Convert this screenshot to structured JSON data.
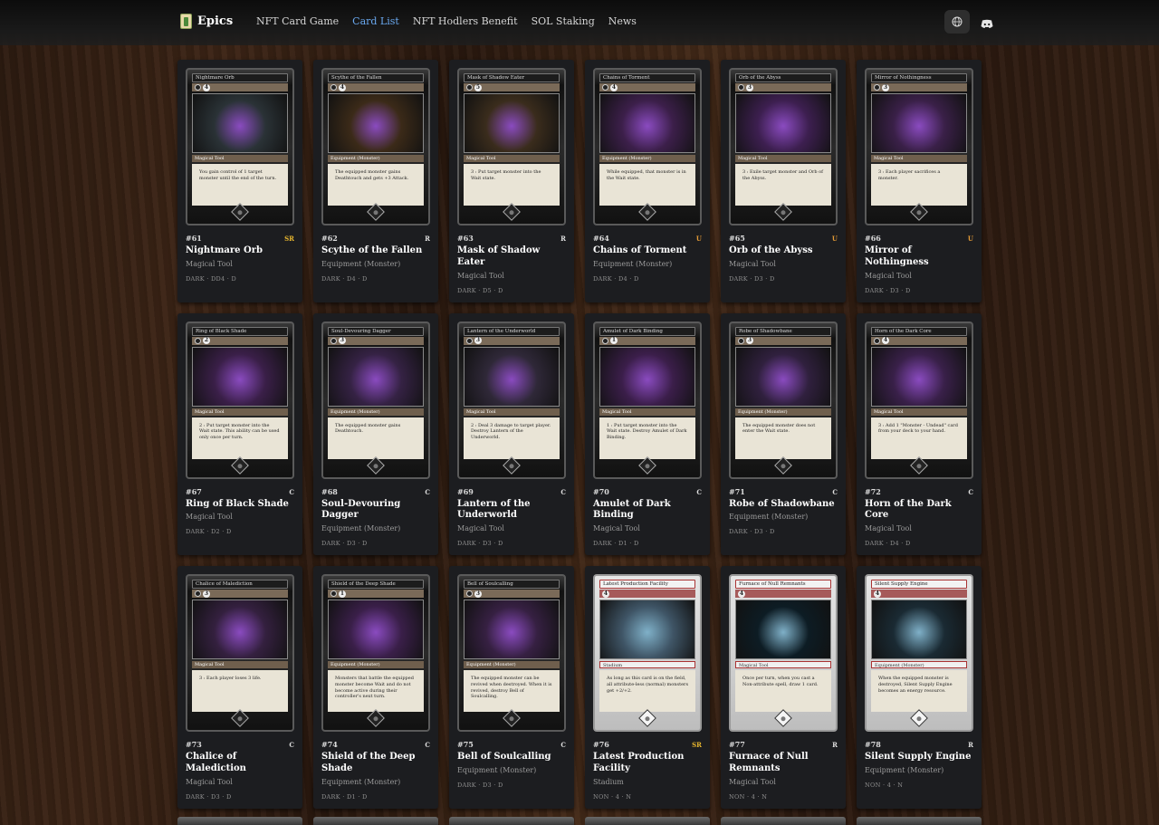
{
  "brand": {
    "name": "Epics"
  },
  "nav": [
    {
      "label": "NFT Card Game",
      "active": false
    },
    {
      "label": "Card List",
      "active": true
    },
    {
      "label": "NFT Hodlers Benefit",
      "active": false
    },
    {
      "label": "SOL Staking",
      "active": false
    },
    {
      "label": "News",
      "active": false
    }
  ],
  "header_icons": [
    "globe-icon",
    "discord-icon"
  ],
  "cards": [
    {
      "number": "#61",
      "name": "Nightmare Orb",
      "type": "Magical Tool",
      "rarity": "SR",
      "stats": "DARK · DD4 · D",
      "cost": "4",
      "art_type": "Magical Tool",
      "text": "You gain control of 1 target monster until the end of the turn.",
      "frame": "dark",
      "art": "#2a3236"
    },
    {
      "number": "#62",
      "name": "Scythe of the Fallen",
      "type": "Equipment (Monster)",
      "rarity": "R",
      "stats": "DARK · D4 · D",
      "cost": "4",
      "art_type": "Equipment (Monster)",
      "text": "The equipped monster gains Deathtouch and gets +3 Attack.",
      "frame": "dark",
      "art": "#3b2a18"
    },
    {
      "number": "#63",
      "name": "Mask of Shadow Eater",
      "type": "Magical Tool",
      "rarity": "R",
      "stats": "DARK · D5 · D",
      "cost": "5",
      "art_type": "Magical Tool",
      "text": "3 : Put target monster into the Wait state.",
      "frame": "dark",
      "art": "#3a2c1c"
    },
    {
      "number": "#64",
      "name": "Chains of Torment",
      "type": "Equipment (Monster)",
      "rarity": "U",
      "stats": "DARK · D4 · D",
      "cost": "4",
      "art_type": "Equipment (Monster)",
      "text": "While equipped, that monster is in the Wait state.",
      "frame": "dark",
      "art": "#3c1f4a"
    },
    {
      "number": "#65",
      "name": "Orb of the Abyss",
      "type": "Magical Tool",
      "rarity": "U",
      "stats": "DARK · D3 · D",
      "cost": "3",
      "art_type": "Magical Tool",
      "text": "3 : Exile target monster and Orb of the Abyss.",
      "frame": "dark",
      "art": "#3d1f50"
    },
    {
      "number": "#66",
      "name": "Mirror of Nothingness",
      "type": "Magical Tool",
      "rarity": "U",
      "stats": "DARK · D3 · D",
      "cost": "3",
      "art_type": "Magical Tool",
      "text": "3 : Each player sacrifices a monster.",
      "frame": "dark",
      "art": "#3a2048"
    },
    {
      "number": "#67",
      "name": "Ring of Black Shade",
      "type": "Magical Tool",
      "rarity": "C",
      "stats": "DARK · D2 · D",
      "cost": "2",
      "art_type": "Magical Tool",
      "text": "2 : Put target monster into the Wait state. This ability can be used only once per turn.",
      "frame": "dark",
      "art": "#3a1f48"
    },
    {
      "number": "#68",
      "name": "Soul-Devouring Dagger",
      "type": "Equipment (Monster)",
      "rarity": "C",
      "stats": "DARK · D3 · D",
      "cost": "3",
      "art_type": "Equipment (Monster)",
      "text": "The equipped monster gains Deathtouch.",
      "frame": "dark",
      "art": "#352244"
    },
    {
      "number": "#69",
      "name": "Lantern of the Underworld",
      "type": "Magical Tool",
      "rarity": "C",
      "stats": "DARK · D3 · D",
      "cost": "3",
      "art_type": "Magical Tool",
      "text": "2 : Deal 3 damage to target player. Destroy Lantern of the Underworld.",
      "frame": "dark",
      "art": "#2f2838"
    },
    {
      "number": "#70",
      "name": "Amulet of Dark Binding",
      "type": "Magical Tool",
      "rarity": "C",
      "stats": "DARK · D1 · D",
      "cost": "1",
      "art_type": "Magical Tool",
      "text": "1 : Put target monster into the Wait state. Destroy Amulet of Dark Binding.",
      "frame": "dark",
      "art": "#3b1e4a"
    },
    {
      "number": "#71",
      "name": "Robe of Shadowbane",
      "type": "Equipment (Monster)",
      "rarity": "C",
      "stats": "DARK · D3 · D",
      "cost": "3",
      "art_type": "Equipment (Monster)",
      "text": "The equipped monster does not enter the Wait state.",
      "frame": "dark",
      "art": "#30203e"
    },
    {
      "number": "#72",
      "name": "Horn of the Dark Core",
      "type": "Magical Tool",
      "rarity": "C",
      "stats": "DARK · D4 · D",
      "cost": "4",
      "art_type": "Magical Tool",
      "text": "3 : Add 1 \"Monster - Undead\" card from your deck to your hand.",
      "frame": "dark",
      "art": "#392049"
    },
    {
      "number": "#73",
      "name": "Chalice of Malediction",
      "type": "Magical Tool",
      "rarity": "C",
      "stats": "DARK · D3 · D",
      "cost": "3",
      "art_type": "Magical Tool",
      "text": "3 : Each player loses 3 life.",
      "frame": "dark",
      "art": "#34203f"
    },
    {
      "number": "#74",
      "name": "Shield of the Deep Shade",
      "type": "Equipment (Monster)",
      "rarity": "C",
      "stats": "DARK · D1 · D",
      "cost": "1",
      "art_type": "Equipment (Monster)",
      "text": "Monsters that battle the equipped monster become Wait and do not become active during their controller's next turn.",
      "frame": "dark",
      "art": "#3a1f49"
    },
    {
      "number": "#75",
      "name": "Bell of Soulcalling",
      "type": "Equipment (Monster)",
      "rarity": "C",
      "stats": "DARK · D3 · D",
      "cost": "3",
      "art_type": "Equipment (Monster)",
      "text": "The equipped monster can be revived when destroyed. When it is revived, destroy Bell of Soulcalling.",
      "frame": "dark",
      "art": "#362042"
    },
    {
      "number": "#76",
      "name": "Latest Production Facility",
      "type": "Stadium",
      "rarity": "SR",
      "stats": "NON · 4 · N",
      "cost": "4",
      "art_type": "Stadium",
      "text": "As long as this card is on the field, all attribute-less (normal) monsters get +2/+2.",
      "frame": "light",
      "art": "#3f5566"
    },
    {
      "number": "#77",
      "name": "Furnace of Null Remnants",
      "type": "Magical Tool",
      "rarity": "R",
      "stats": "NON · 4 · N",
      "cost": "4",
      "art_type": "Magical Tool",
      "text": "Once per turn, when you cast a Non-attribute spell, draw 1 card.",
      "frame": "light",
      "art": "#0d1c24"
    },
    {
      "number": "#78",
      "name": "Silent Supply Engine",
      "type": "Equipment (Monster)",
      "rarity": "R",
      "stats": "NON · 4 · N",
      "cost": "4",
      "art_type": "Equipment (Monster)",
      "text": "When the equipped monster is destroyed, Silent Supply Engine becomes an energy resource.",
      "frame": "light",
      "art": "#1a2a33"
    }
  ]
}
